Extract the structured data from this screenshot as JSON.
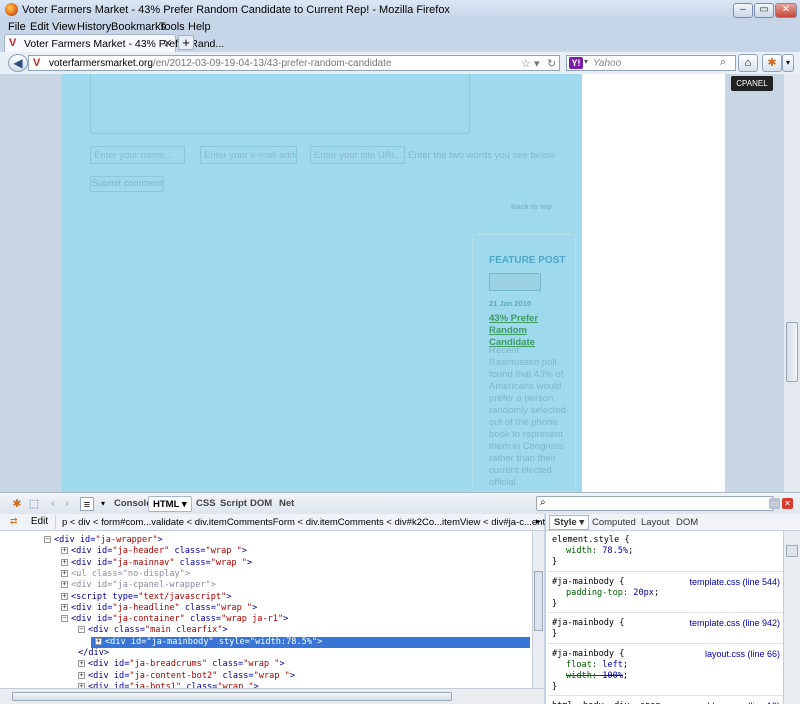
{
  "window": {
    "title": "Voter Farmers Market - 43% Prefer Random Candidate to Current Rep! - Mozilla Firefox"
  },
  "menu": [
    "File",
    "Edit",
    "View",
    "History",
    "Bookmarks",
    "Tools",
    "Help"
  ],
  "tab": {
    "title": "Voter Farmers Market - 43% Prefer Rand...",
    "favicon": "V"
  },
  "url": {
    "domain": "voterfarmersmarket.org",
    "path": "/en/2012-03-09-19-04-13/43-prefer-random-candidate"
  },
  "search": {
    "engine": "Y!",
    "placeholder": "Yahoo"
  },
  "tooltip": "CPANEL",
  "page": {
    "name_placeholder": "Enter your name...",
    "email_placeholder": "Enter your e-mail addre",
    "url_placeholder": "Enter your site URL...",
    "captcha_hint": "Enter the two words you see below",
    "submit": "Submit comment",
    "back_to_top": "Back to top",
    "feature": {
      "heading": "FEATURE POST",
      "date": "21 Jan 2010",
      "link": "43% Prefer Random Candidate",
      "body": "Recent Rasmussen poll found that 43% of Americans would prefer a person randomly selected out of the phone book to represent them in Congress rather than their current elected official."
    }
  },
  "firebug": {
    "tabs": [
      "Console",
      "HTML",
      "CSS",
      "Script",
      "DOM",
      "Net"
    ],
    "active_tab": "HTML",
    "edit": "Edit",
    "breadcrumbs": "p < div < form#com...validate < div.itemCommentsForm < div.itemComments < div#k2Co...itemView < div#ja-c...ent-n",
    "side_tabs": [
      "Style",
      "Computed",
      "Layout",
      "DOM"
    ],
    "html_lines": [
      {
        "t": "<div",
        "a": [
          [
            "id",
            "ja-wrapper"
          ]
        ],
        "tog": "-",
        "ind": 0
      },
      {
        "t": "<div",
        "a": [
          [
            "id",
            "ja-header"
          ],
          [
            "class",
            "wrap "
          ]
        ],
        "tog": "+",
        "ind": 1,
        "close": true
      },
      {
        "t": "<div",
        "a": [
          [
            "id",
            "ja-mainnav"
          ],
          [
            "class",
            "wrap "
          ]
        ],
        "tog": "+",
        "ind": 1,
        "close": true
      },
      {
        "t": "<ul",
        "a": [
          [
            "class",
            "no-display"
          ]
        ],
        "tog": "+",
        "ind": 1,
        "close": true,
        "dim": true
      },
      {
        "t": "<div",
        "a": [
          [
            "id",
            "ja-cpanel-wrapper"
          ]
        ],
        "tog": "+",
        "ind": 1,
        "close": true,
        "dim": true
      },
      {
        "t": "<script",
        "a": [
          [
            "type",
            "text/javascript"
          ]
        ],
        "tog": "+",
        "ind": 1,
        "close": true
      },
      {
        "t": "<div",
        "a": [
          [
            "id",
            "ja-headline"
          ],
          [
            "class",
            "wrap "
          ]
        ],
        "tog": "+",
        "ind": 1,
        "close": true
      },
      {
        "t": "<div",
        "a": [
          [
            "id",
            "ja-container"
          ],
          [
            "class",
            "wrap ja-r1"
          ]
        ],
        "tog": "-",
        "ind": 1
      },
      {
        "t": "<div",
        "a": [
          [
            "class",
            "main clearfix"
          ]
        ],
        "tog": "-",
        "ind": 2
      },
      {
        "t": "<div",
        "a": [
          [
            "id",
            "ja-mainbody"
          ],
          [
            "style",
            "width:78.5%"
          ]
        ],
        "tog": "+",
        "ind": 3,
        "sel": true
      },
      {
        "t": "</div>",
        "a": [],
        "tog": "",
        "ind": 2
      },
      {
        "t": "<div",
        "a": [
          [
            "id",
            "ja-breadcrums"
          ],
          [
            "class",
            "wrap "
          ]
        ],
        "tog": "+",
        "ind": 2,
        "close": true
      },
      {
        "t": "<div",
        "a": [
          [
            "id",
            "ja-content-bot2"
          ],
          [
            "class",
            "wrap "
          ]
        ],
        "tog": "+",
        "ind": 2,
        "close": true
      },
      {
        "t": "<div",
        "a": [
          [
            "id",
            "ja-bots1"
          ],
          [
            "class",
            "wrap "
          ]
        ],
        "tog": "+",
        "ind": 2,
        "close": true
      }
    ],
    "css_rules": [
      {
        "sel": "element.style {",
        "props": [
          [
            "width",
            "78.5%",
            false
          ]
        ],
        "src": ""
      },
      {
        "sel": "#ja-mainbody {",
        "props": [
          [
            "padding-top",
            "20px",
            false
          ]
        ],
        "src": "template.css (line 544)"
      },
      {
        "sel": "#ja-mainbody {",
        "props": [],
        "src": "template.css (line 942)"
      },
      {
        "sel": "#ja-mainbody {",
        "props": [
          [
            "float",
            "left",
            false
          ],
          [
            "width",
            "100%",
            true
          ]
        ],
        "src": "layout.css (line 66)"
      }
    ],
    "last_rule_selector": [
      "html, body, div, span,",
      "applet, object, iframe,",
      "h1, h2, h3, h4, h5, h6, p,"
    ],
    "last_rule_src": "addons.css (line 19)"
  }
}
